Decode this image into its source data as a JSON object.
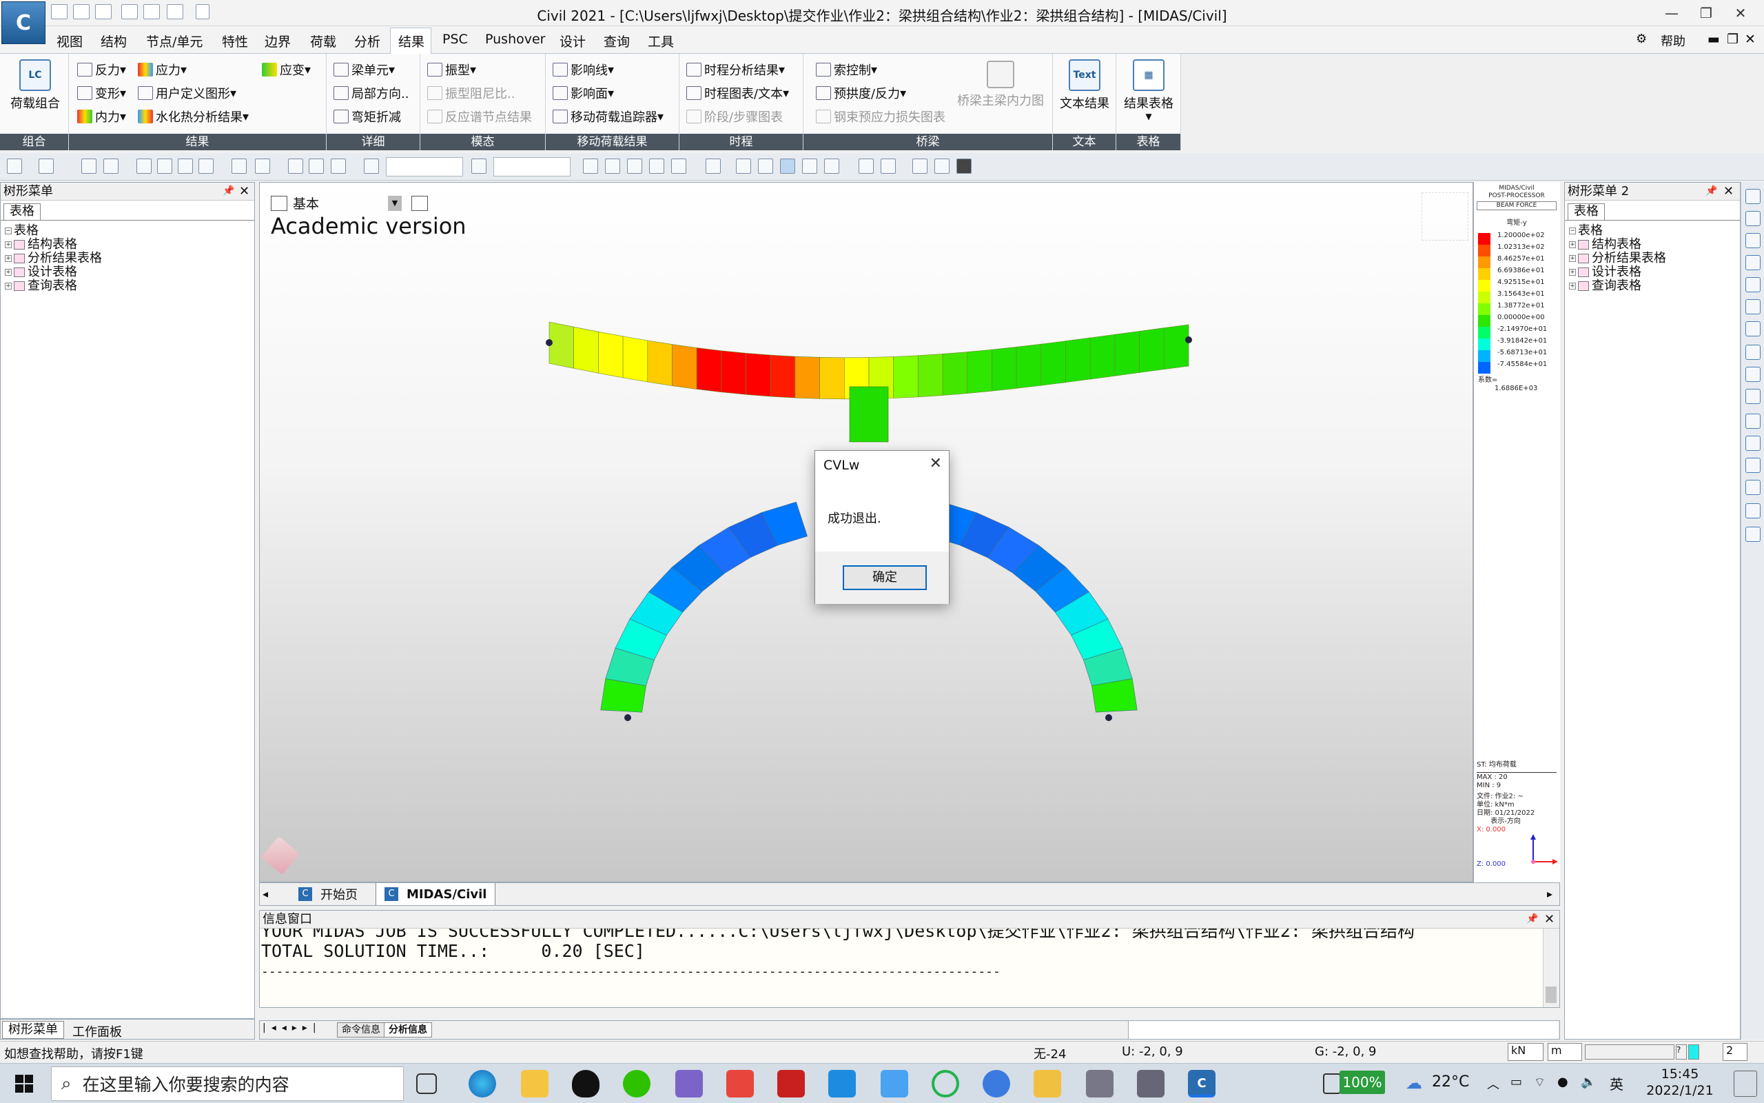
{
  "window": {
    "title": "Civil 2021 - [C:\\Users\\ljfwxj\\Desktop\\提交作业\\作业2：梁拱组合结构\\作业2：梁拱组合结构] - [MIDAS/Civil]",
    "logo": "C"
  },
  "menu": {
    "items": [
      "视图",
      "结构",
      "节点/单元",
      "特性",
      "边界",
      "荷载",
      "分析",
      "结果",
      "PSC",
      "Pushover",
      "设计",
      "查询",
      "工具"
    ],
    "active": "结果",
    "help": "帮助"
  },
  "ribbon": {
    "groups": {
      "combo": {
        "label": "组合",
        "btn": "荷载组合",
        "icon_text": "LC"
      },
      "results": {
        "label": "结果",
        "reaction": "反力",
        "deform": "变形",
        "force": "内力",
        "stress": "应力",
        "user_graph": "用户定义图形",
        "heat": "水化热分析结果",
        "strain": "应变"
      },
      "detail": {
        "label": "详细",
        "beam": "梁单元",
        "local_dir": "局部方向..",
        "moment_reduce": "弯矩折减"
      },
      "mode": {
        "label": "模态",
        "vib": "振型",
        "damping": "振型阻尼比..",
        "spectrum": "反应谱节点结果"
      },
      "moving": {
        "label": "移动荷载结果",
        "infl_line": "影响线",
        "infl_surf": "影响面",
        "tracer": "移动荷载追踪器"
      },
      "time": {
        "label": "时程",
        "th_result": "时程分析结果",
        "th_graph": "时程图表/文本",
        "stage": "阶段/步骤图表"
      },
      "bridge": {
        "label": "桥梁",
        "cable": "索控制",
        "camber": "预拱度/反力",
        "tendon": "钢束预应力损失图表",
        "girder": "桥梁主梁内力图"
      },
      "text": {
        "label": "文本",
        "btn": "文本结果",
        "icon_text": "Text"
      },
      "table": {
        "label": "表格",
        "btn": "结果表格"
      }
    }
  },
  "left_panel": {
    "title": "树形菜单",
    "tab": "表格",
    "tree": [
      "表格",
      "结构表格",
      "分析结果表格",
      "设计表格",
      "查询表格"
    ],
    "bottom_tabs": [
      "树形菜单",
      "工作面板"
    ]
  },
  "right_panel": {
    "title": "树形菜单 2",
    "tab": "表格",
    "tree": [
      "表格",
      "结构表格",
      "分析结果表格",
      "设计表格",
      "查询表格"
    ]
  },
  "viewport": {
    "view_label": "基本",
    "watermark": "Academic version",
    "tabs": [
      "开始页",
      "MIDAS/Civil"
    ]
  },
  "legend": {
    "header": [
      "MIDAS/Civil",
      "POST-PROCESSOR",
      "BEAM FORCE"
    ],
    "component": "弯矩-y",
    "values": [
      "1.20000e+02",
      "1.02313e+02",
      "8.46257e+01",
      "6.69386e+01",
      "4.92515e+01",
      "3.15643e+01",
      "1.38772e+01",
      "0.00000e+00",
      "-2.14970e+01",
      "-3.91842e+01",
      "-5.68713e+01",
      "-7.45584e+01"
    ],
    "colors": [
      "#ff0000",
      "#ff4d00",
      "#ff9900",
      "#ffd000",
      "#ffff00",
      "#ccff00",
      "#7fff00",
      "#2ee600",
      "#00ff66",
      "#00ffd9",
      "#00b3ff",
      "#0066ff"
    ],
    "factor_label": "系数=",
    "factor": "1.6886E+03",
    "st": "ST: 均布荷载",
    "max": "MAX : 20",
    "min": "MIN : 9",
    "file": "文件: 作业2: ~",
    "unit": "单位: kN*m",
    "date": "日期: 01/21/2022",
    "view_dir": "表示-方向",
    "x_coord": "X: 0.000",
    "z_coord": "Z: 0.000"
  },
  "dialog": {
    "title": "CVLw",
    "message": "成功退出.",
    "ok": "确定"
  },
  "info_window": {
    "title": "信息窗口",
    "line1": "YOUR MIDAS JOB IS SUCCESSFULLY COMPLETED......C:\\Users\\ljfwxj\\Desktop\\提交作业\\作业2: 梁拱组合结构\\作业2: 梁拱组合结构",
    "line2": "TOTAL SOLUTION TIME..:     0.20 [SEC]",
    "line3": "---------------------------------------------------------------------------------------------------",
    "tabs": [
      "命令信息",
      "分析信息"
    ]
  },
  "status": {
    "help_hint": "如想查找帮助，请按F1键",
    "none": "无-24",
    "u": "U: -2, 0, 9",
    "g": "G: -2, 0, 9",
    "unit_force": "kN",
    "unit_len": "m",
    "page": "2"
  },
  "taskbar": {
    "search_placeholder": "在这里输入你要搜索的内容",
    "battery": "100%",
    "temp": "22°C",
    "ime": "英",
    "time": "15:45",
    "date": "2022/1/21"
  }
}
